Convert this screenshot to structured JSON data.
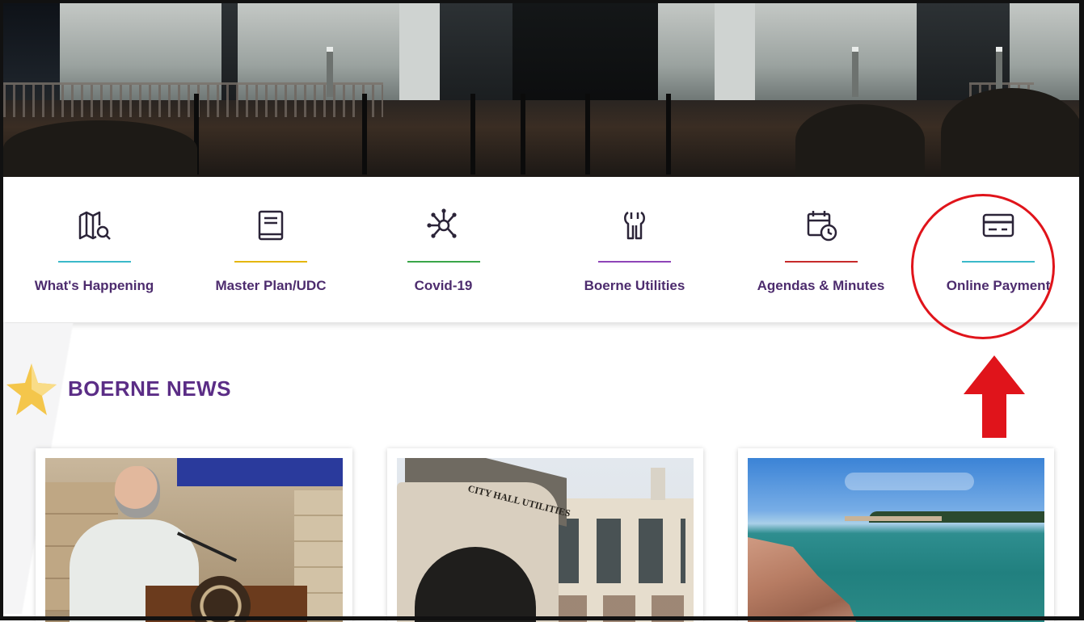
{
  "quick_links": [
    {
      "label": "What's Happening",
      "icon": "map-search-icon",
      "accent": "#3bb9c9"
    },
    {
      "label": "Master Plan/UDC",
      "icon": "book-icon",
      "accent": "#e5b70f"
    },
    {
      "label": "Covid-19",
      "icon": "network-icon",
      "accent": "#3aa649"
    },
    {
      "label": "Boerne Utilities",
      "icon": "wrench-icon",
      "accent": "#8e44b8"
    },
    {
      "label": "Agendas & Minutes",
      "icon": "calendar-clock-icon",
      "accent": "#c72a2a"
    },
    {
      "label": "Online Payment",
      "icon": "credit-card-icon",
      "accent": "#3bb9c9"
    }
  ],
  "news": {
    "title": "BOERNE NEWS",
    "icon": "star-icon",
    "cards": [
      {
        "image": "news-photo-governor-press-conference",
        "sign_text": ""
      },
      {
        "image": "news-photo-city-hall",
        "sign_text": "CITY HALL UTILITIES"
      },
      {
        "image": "news-photo-lake"
      }
    ]
  },
  "colors": {
    "label": "#4d2c6e",
    "news_title": "#5b2d86",
    "annotation": "#e0141b"
  }
}
